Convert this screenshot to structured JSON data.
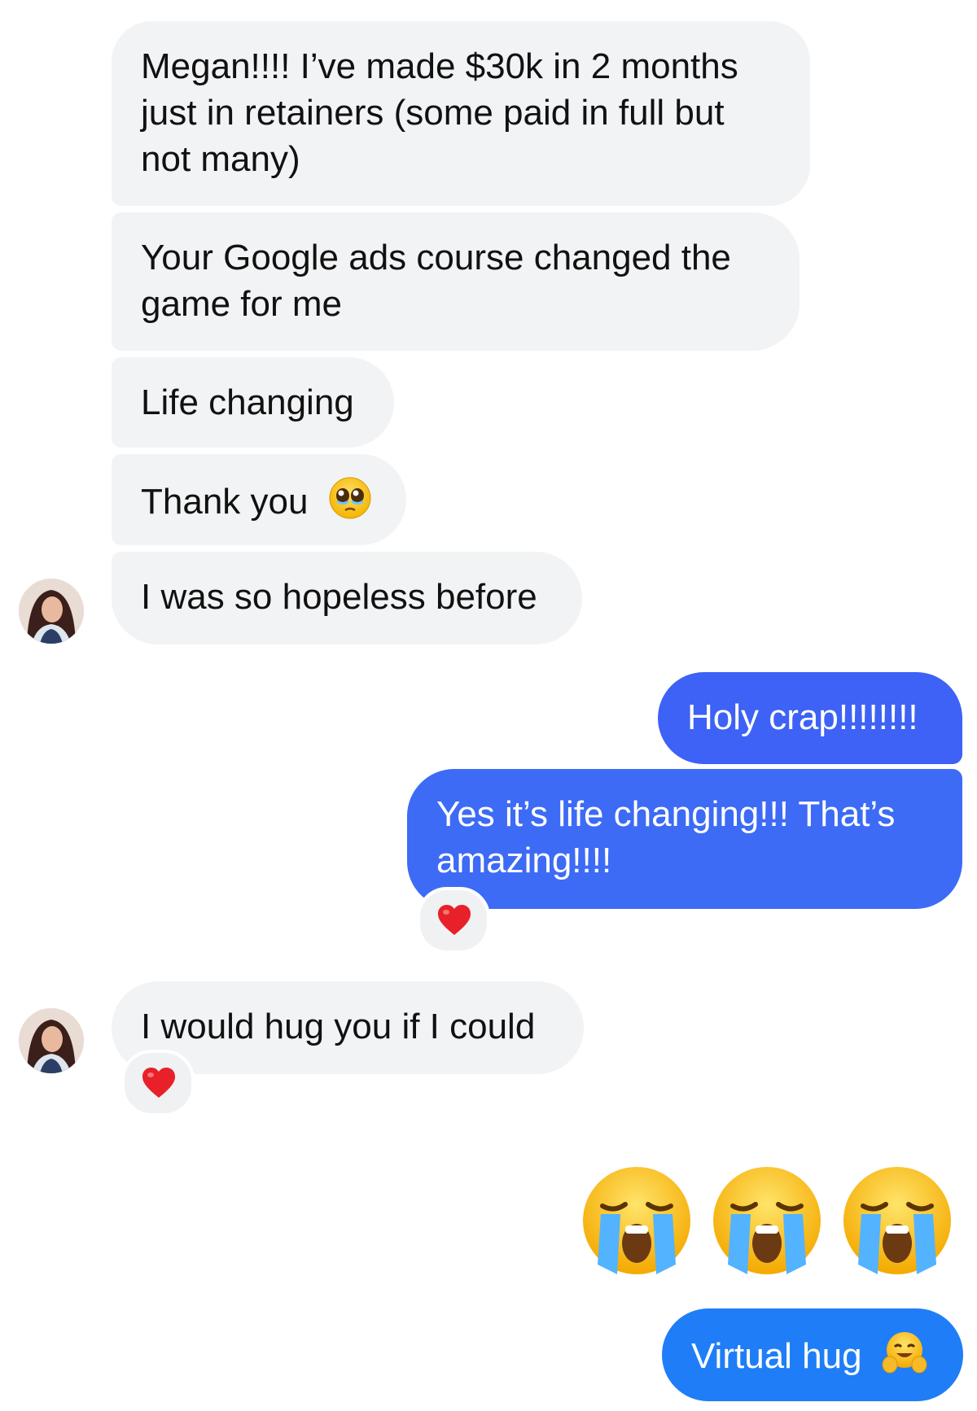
{
  "conversation": {
    "incoming": [
      {
        "text": "Megan!!!! I’ve made $30k in 2 months just in retainers (some paid in full but not many)"
      },
      {
        "text": "Your Google ads course changed the game for me"
      },
      {
        "text": "Life changing"
      },
      {
        "text": "Thank you",
        "emoji": "pleading-face"
      },
      {
        "text": "I was so hopeless before"
      },
      {
        "text": "I would hug you if I could",
        "reaction": "heart"
      }
    ],
    "outgoing": [
      {
        "text": "Holy crap!!!!!!!!"
      },
      {
        "text": "Yes it’s life changing!!! That’s amazing!!!!",
        "reaction": "heart"
      },
      {
        "emoji_only": [
          "loudly-crying-face",
          "loudly-crying-face",
          "loudly-crying-face"
        ]
      },
      {
        "text": "Virtual hug",
        "emoji": "hugging-face"
      }
    ]
  },
  "colors": {
    "incoming_bubble": "#f2f3f5",
    "outgoing_bubble_1": "#3d62f5",
    "outgoing_bubble_2": "#3d6bf6",
    "outgoing_bubble_3": "#1f7ef7",
    "reaction_heart": "#e8202a"
  }
}
